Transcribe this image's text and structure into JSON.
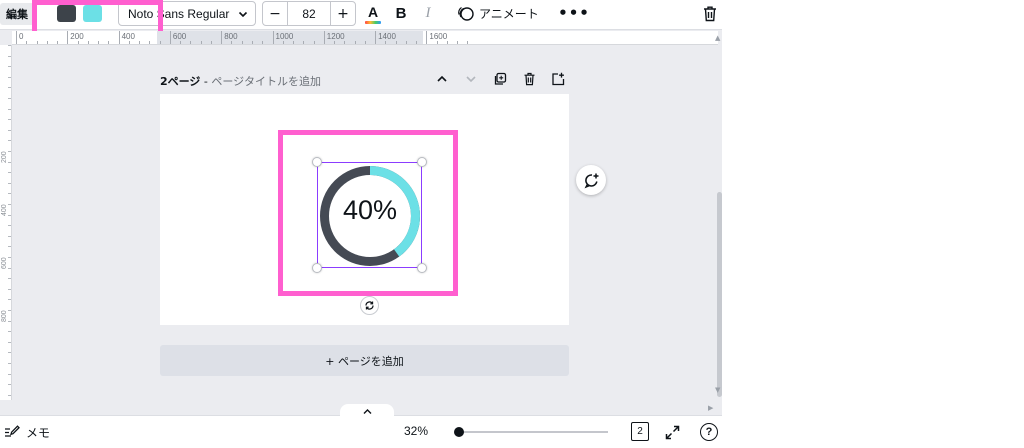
{
  "colors": {
    "highlight": "#ff5fcf",
    "swatch_dark": "#3d434a",
    "swatch_cyan": "#6ce0e6",
    "selection": "#8b3dff",
    "ring_dark": "#454a54",
    "ring_cyan": "#6ce0e6"
  },
  "toolbar": {
    "edit_label": "編集",
    "font_name": "Noto Sans Regular",
    "font_size": "82",
    "minus_label": "−",
    "plus_label": "+",
    "text_color_letter": "A",
    "bold_label": "B",
    "italic_label": "I",
    "animate_label": "アニメート",
    "more_label": "•••"
  },
  "ruler": {
    "labels": [
      "0",
      "200",
      "400",
      "600",
      "800",
      "1000",
      "1200",
      "1400",
      "1600"
    ],
    "vertical_labels": [
      "200",
      "400",
      "600",
      "800"
    ]
  },
  "page": {
    "number": "2ページ",
    "separator": " - ",
    "title_placeholder": "ページタイトルを追加"
  },
  "element": {
    "text": "40%",
    "progress": 0.4
  },
  "add_page_label": "+ ページを追加",
  "bottom": {
    "memo_label": "メモ",
    "zoom": "32%",
    "zoom_level": 0.32,
    "page_count": "2",
    "help_label": "?"
  },
  "icons": [
    "pencil-notes-icon",
    "chevron-up-icon",
    "chevron-down-icon",
    "duplicate-icon",
    "trash-icon",
    "add-page-icon",
    "rotate-icon",
    "comment-add-icon",
    "fullscreen-icon",
    "animate-icon"
  ]
}
